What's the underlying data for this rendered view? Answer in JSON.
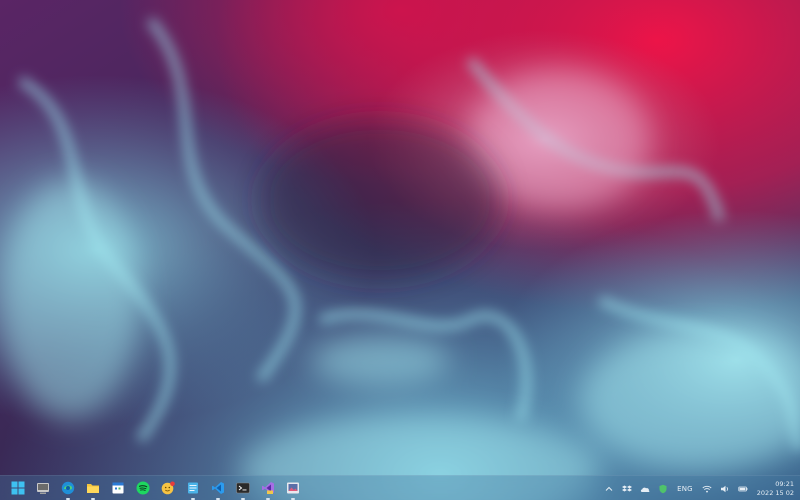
{
  "desktop": {
    "wallpaper": "abstract ink-smoke wallpaper",
    "colors": {
      "top_right": "#e0154a",
      "top_left": "#6a2a6e",
      "center": "#3b2a5a",
      "smoke": "#8fe1ef",
      "bottom": "#2a5f8a"
    }
  },
  "taskbar": {
    "pinned": [
      {
        "icon": "windows-start-icon",
        "running": false
      },
      {
        "icon": "show-desktop-icon",
        "running": false
      },
      {
        "icon": "edge-browser-icon",
        "running": true
      },
      {
        "icon": "file-explorer-folder-icon",
        "running": true
      },
      {
        "icon": "calendar-app-icon",
        "running": false
      },
      {
        "icon": "spotify-icon",
        "running": false
      },
      {
        "icon": "emoji-notification-app-icon",
        "running": false
      },
      {
        "icon": "notepad-icon",
        "running": true
      },
      {
        "icon": "vscode-icon",
        "running": true
      },
      {
        "icon": "terminal-icon",
        "running": true
      },
      {
        "icon": "visual-studio-icon",
        "running": true
      },
      {
        "icon": "photos-app-icon",
        "running": true
      }
    ],
    "tray": {
      "icons": [
        "chevron-up-icon",
        "dropbox-icon",
        "onedrive-cloud-icon",
        "security-shield-icon"
      ],
      "language": "ENG",
      "status_icons": [
        "wifi-icon",
        "volume-icon",
        "battery-icon"
      ],
      "clock": {
        "time": "09:21",
        "date": "2022 15 02"
      }
    }
  }
}
